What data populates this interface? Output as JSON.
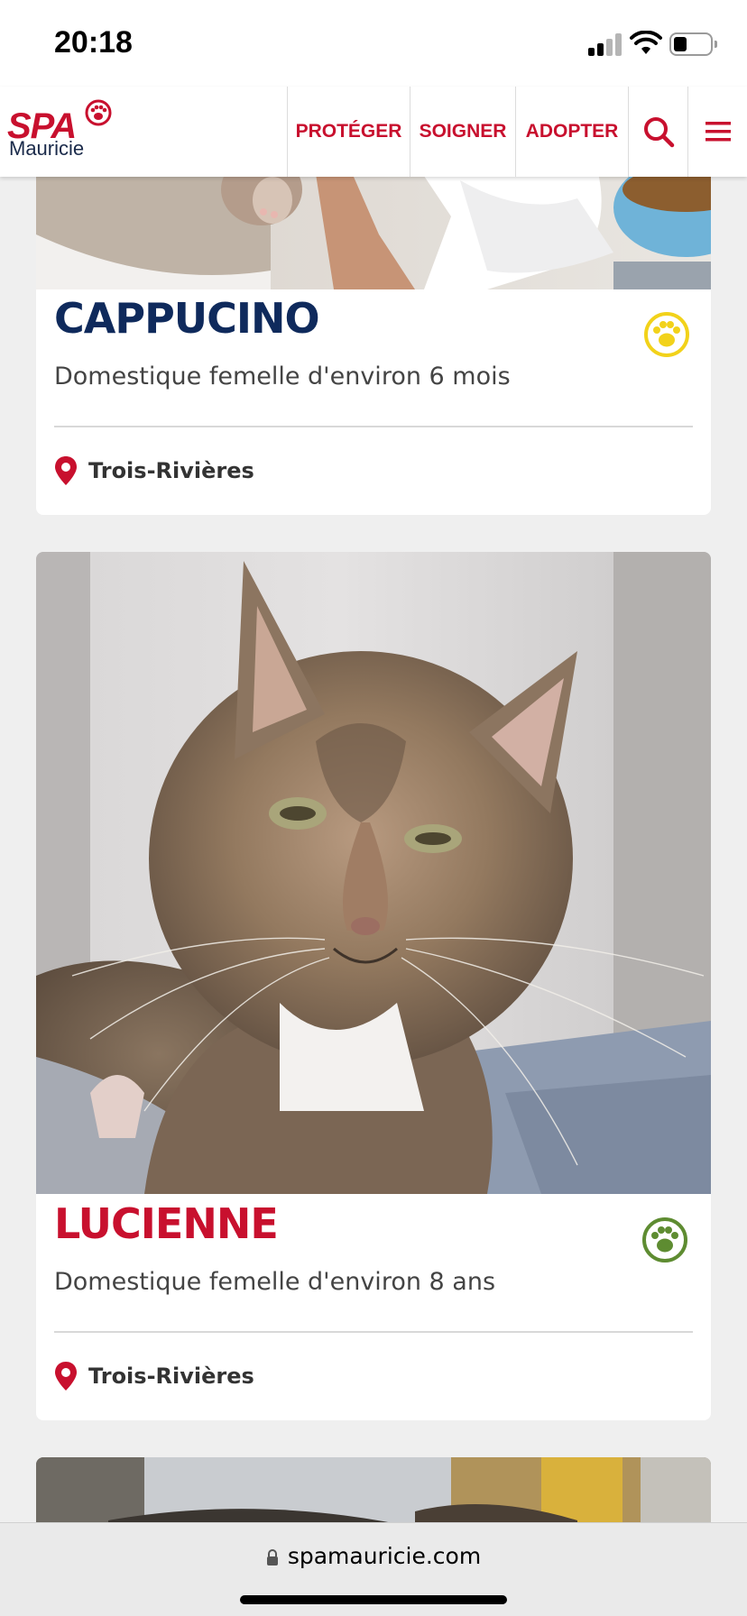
{
  "status_bar": {
    "time": "20:18",
    "icons": [
      "cellular-signal-icon",
      "wifi-icon",
      "battery-icon"
    ]
  },
  "header": {
    "logo": {
      "brand": "SPA",
      "sub": "Mauricie"
    },
    "nav": [
      {
        "label": "PROTÉGER"
      },
      {
        "label": "SOIGNER"
      },
      {
        "label": "ADOPTER"
      }
    ],
    "icons": [
      "search-icon",
      "menu-icon"
    ],
    "accent_color": "#c8102e"
  },
  "animals": [
    {
      "name": "CAPPUCINO",
      "name_color": "#0f2a5c",
      "description": "Domestique femelle d'environ 6 mois",
      "location": "Trois-Rivières",
      "badge_icon": "paw-icon",
      "badge_color": "#f2d21a"
    },
    {
      "name": "LUCIENNE",
      "name_color": "#c8102e",
      "description": "Domestique femelle d'environ 8 ans",
      "location": "Trois-Rivières",
      "badge_icon": "paw-icon",
      "badge_color": "#5e8c31"
    }
  ],
  "browser": {
    "url": "spamauricie.com"
  }
}
